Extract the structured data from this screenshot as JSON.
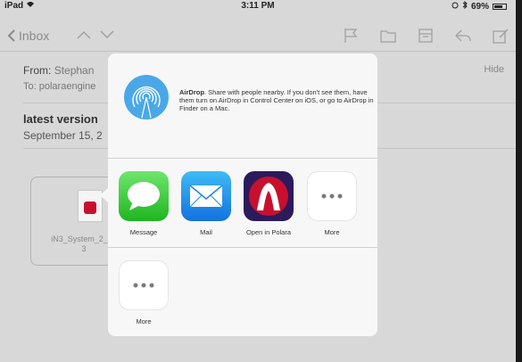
{
  "status_bar": {
    "device": "iPad",
    "time": "3:11 PM",
    "battery": "69%"
  },
  "nav": {
    "back_label": "Inbox"
  },
  "mail": {
    "from_label": "From:",
    "from_name": "Stephan",
    "to_label": "To:",
    "to_value": "polaraengine",
    "hide_label": "Hide",
    "subject": "latest version",
    "date": "September 15, 2",
    "attachment_name_line1": "iN3_System_2_10",
    "attachment_name_line2": "3"
  },
  "share_sheet": {
    "airdrop_bold": "AirDrop",
    "airdrop_text": ". Share with people nearby. If you don't see them, have them turn on AirDrop in Control Center on iOS, or go to AirDrop in Finder on a Mac.",
    "apps": [
      {
        "label": "Message",
        "icon": "message-icon"
      },
      {
        "label": "Mail",
        "icon": "mail-icon"
      },
      {
        "label": "Open in Polara",
        "icon": "polara-icon"
      },
      {
        "label": "More",
        "icon": "more-icon"
      }
    ],
    "actions": [
      {
        "label": "More",
        "icon": "more-icon"
      }
    ]
  },
  "colors": {
    "accent": "#8a8a8a",
    "polara_red": "#c8102e",
    "polara_bg": "#2c1a5c"
  }
}
